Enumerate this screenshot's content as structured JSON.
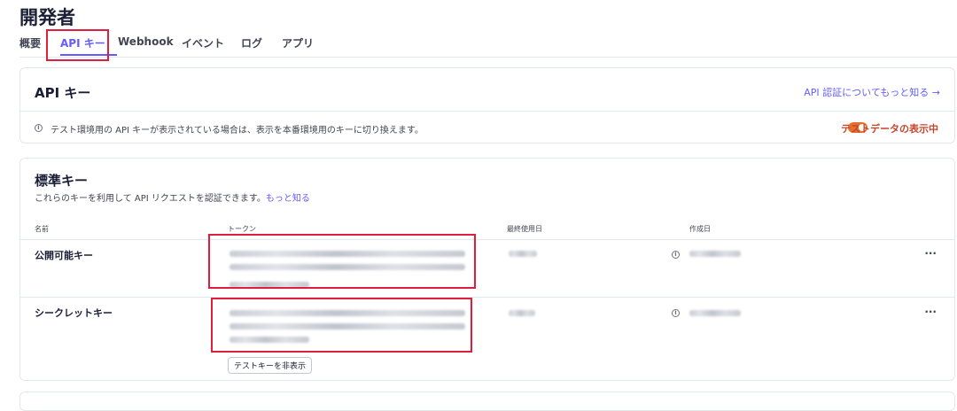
{
  "page": {
    "title": "開発者"
  },
  "tabs": [
    {
      "label": "概要"
    },
    {
      "label": "API キー"
    },
    {
      "label": "Webhook"
    },
    {
      "label": "イベント"
    },
    {
      "label": "ログ"
    },
    {
      "label": "アプリ"
    }
  ],
  "api_card": {
    "title": "API キー",
    "learn_link": "API 認証についてもっと知る →",
    "info_text": "テスト環境用の API キーが表示されている場合は、表示を本番環境用のキーに切り換えます。",
    "toggle_label": "テストデータの表示中",
    "toggle_on": true
  },
  "standard_keys": {
    "title": "標準キー",
    "description": "これらのキーを利用して API リクエストを認証できます。",
    "more_link": "もっと知る",
    "columns": [
      "名前",
      "トークン",
      "最終使用日",
      "作成日"
    ],
    "rows": [
      {
        "name": "公開可能キー"
      },
      {
        "name": "シークレットキー"
      }
    ],
    "hide_button": "テストキーを非表示"
  },
  "icons": {
    "info": "info-icon",
    "more": "more-icon",
    "arrow": "arrow-right-icon"
  },
  "colors": {
    "accent": "#635bff",
    "toggle": "#e56f2b",
    "highlight": "#e01e3c"
  }
}
